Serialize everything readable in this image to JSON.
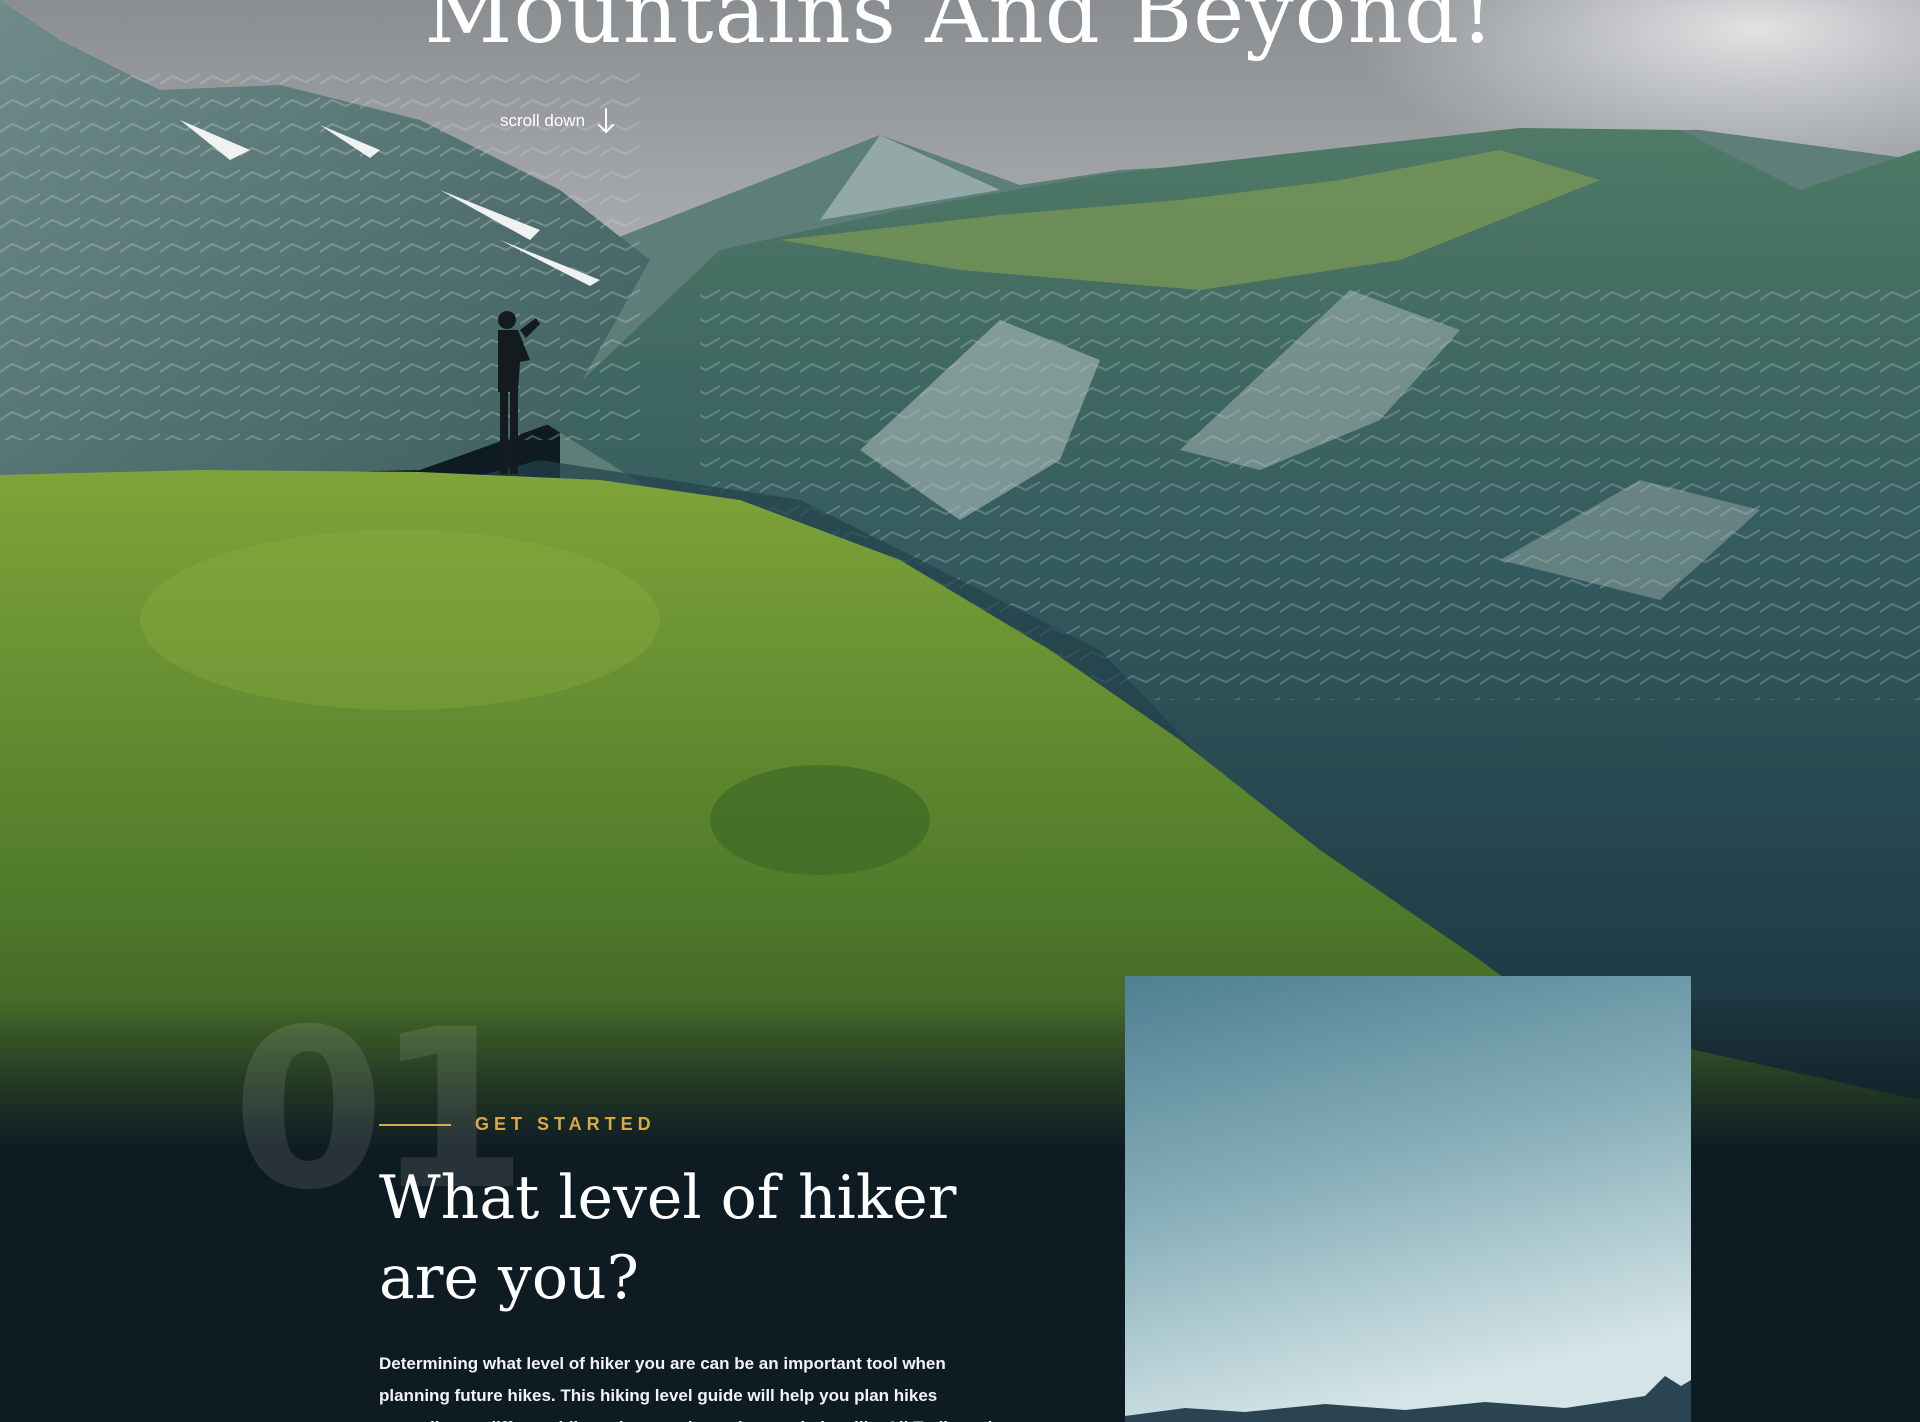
{
  "hero": {
    "title": "Mountains And Beyond!",
    "scroll_label": "scroll down"
  },
  "intro": {
    "number": "01",
    "eyebrow": "GET STARTED",
    "heading": "What level of  hiker are you?",
    "body": "Determining what level of hiker you are can be an important tool when planning future hikes. This hiking level guide will help you plan hikes according to different hike ratings set by various websites like All Trails and"
  },
  "icons": {
    "scroll": "arrow-down-icon"
  },
  "colors": {
    "accent": "#d8a94a",
    "background": "#0f1b23",
    "text": "#ffffff"
  }
}
